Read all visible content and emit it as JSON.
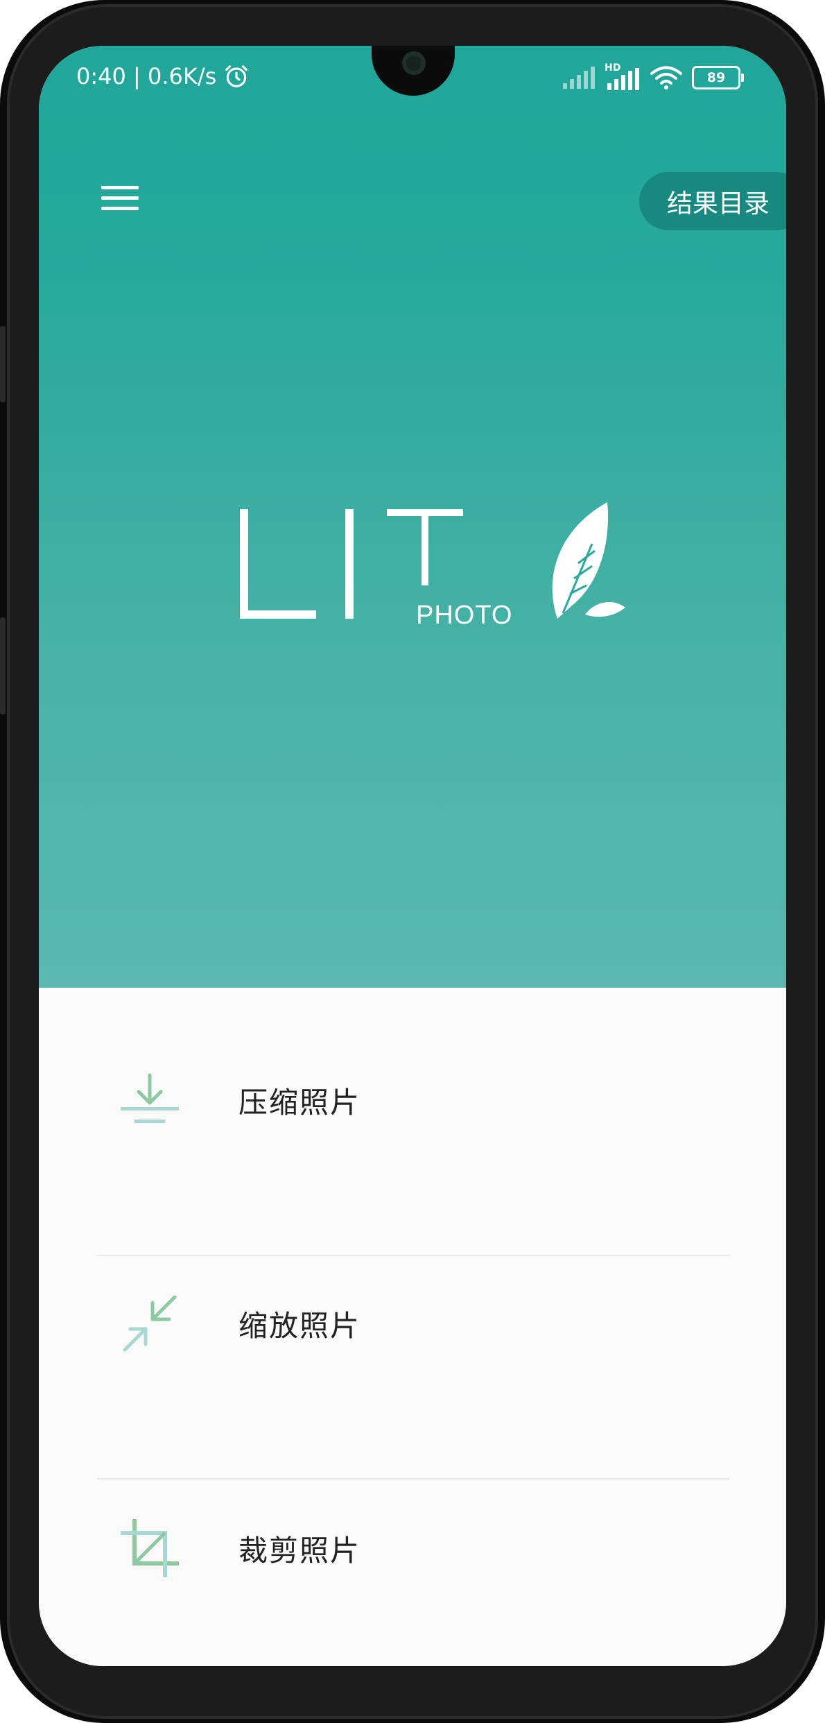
{
  "status_bar": {
    "time_speed": "0:40 | 0.6K/s",
    "battery": "89",
    "network_badge": "HD",
    "icons": [
      "alarm-icon",
      "signal-icon",
      "signal-hd-icon",
      "wifi-icon",
      "battery-icon"
    ]
  },
  "toolbar": {
    "menu_icon": "hamburger-menu-icon",
    "results_label": "结果目录"
  },
  "logo": {
    "letters": "LIT",
    "sub": "PHOTO",
    "icon": "feather-leaf-icon"
  },
  "actions": [
    {
      "label": "压缩照片",
      "icon": "compress-download-icon"
    },
    {
      "label": "缩放照片",
      "icon": "scale-arrows-icon"
    },
    {
      "label": "裁剪照片",
      "icon": "crop-icon"
    }
  ],
  "colors": {
    "header_top": "#20a79a",
    "header_bottom": "#5ab8b0",
    "results_button": "#178a80",
    "icon_green": "#8cc9a0",
    "icon_teal": "#a8d8cf",
    "list_background": "#fafafa"
  }
}
